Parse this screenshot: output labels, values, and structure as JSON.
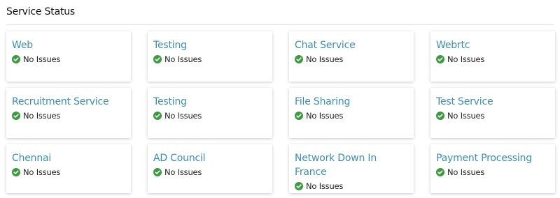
{
  "page": {
    "section_title": "Service Status"
  },
  "colors": {
    "service_name": "#3a8fb2",
    "ok_status": "#3c9a3f"
  },
  "status_icon": "check-circle-icon",
  "services": [
    {
      "name": "Web",
      "status": "No Issues"
    },
    {
      "name": "Testing",
      "status": "No Issues"
    },
    {
      "name": "Chat Service",
      "status": "No Issues"
    },
    {
      "name": "Webrtc",
      "status": "No Issues"
    },
    {
      "name": "Recruitment Service",
      "status": "No Issues"
    },
    {
      "name": "Testing",
      "status": "No Issues"
    },
    {
      "name": "File Sharing",
      "status": "No Issues"
    },
    {
      "name": "Test Service",
      "status": "No Issues"
    },
    {
      "name": "Chennai",
      "status": "No Issues"
    },
    {
      "name": "AD Council",
      "status": "No Issues"
    },
    {
      "name": "Network Down In France",
      "status": "No Issues"
    },
    {
      "name": "Payment Processing",
      "status": "No Issues"
    }
  ]
}
